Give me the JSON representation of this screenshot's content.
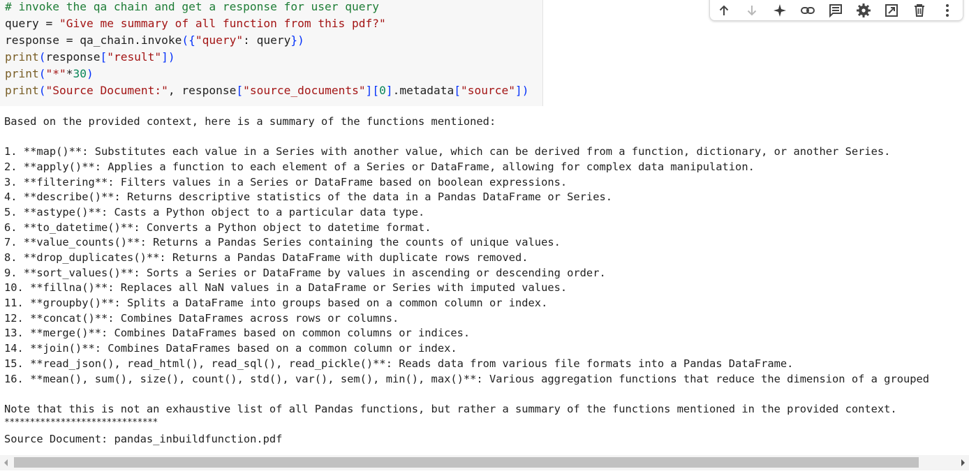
{
  "code": {
    "comment": "# invoke the qa chain and get a response for user query",
    "line2": {
      "var": "query",
      "op": " = ",
      "str": "\"Give me summary of all function from this pdf?\""
    },
    "line3": {
      "var": "response",
      "op": " = ",
      "call": "qa_chain.invoke",
      "open": "({",
      "key": "\"query\"",
      "colon": ": ",
      "arg": "query",
      "close": "})"
    },
    "line4": {
      "fn": "print",
      "open": "(",
      "var": "response",
      "lb": "[",
      "key": "\"result\"",
      "rb": "]",
      "close": ")"
    },
    "line5": {
      "fn": "print",
      "open": "(",
      "str": "\"*\"",
      "op": "*",
      "num": "30",
      "close": ")"
    },
    "line6": {
      "fn": "print",
      "open": "(",
      "str": "\"Source Document:\"",
      "comma": ", ",
      "var": "response",
      "lb1": "[",
      "key1": "\"source_documents\"",
      "rb1": "]",
      "lb2": "[",
      "idx": "0",
      "rb2": "]",
      "attr": ".metadata",
      "lb3": "[",
      "key3": "\"source\"",
      "rb3": "]",
      "close": ")"
    }
  },
  "toolbar": {
    "icons": [
      "arrow-up-icon",
      "arrow-down-icon",
      "sparkle-icon",
      "link-icon",
      "comment-icon",
      "gear-icon",
      "mirror-cell-icon",
      "trash-icon",
      "more-vert-icon"
    ]
  },
  "output": {
    "intro": "Based on the provided context, here is a summary of the functions mentioned:",
    "items": [
      "1. **map()**: Substitutes each value in a Series with another value, which can be derived from a function, dictionary, or another Series.",
      "2. **apply()**: Applies a function to each element of a Series or DataFrame, allowing for complex data manipulation.",
      "3. **filtering**: Filters values in a Series or DataFrame based on boolean expressions.",
      "4. **describe()**: Returns descriptive statistics of the data in a Pandas DataFrame or Series.",
      "5. **astype()**: Casts a Python object to a particular data type.",
      "6. **to_datetime()**: Converts a Python object to datetime format.",
      "7. **value_counts()**: Returns a Pandas Series containing the counts of unique values.",
      "8. **drop_duplicates()**: Returns a Pandas DataFrame with duplicate rows removed.",
      "9. **sort_values()**: Sorts a Series or DataFrame by values in ascending or descending order.",
      "10. **fillna()**: Replaces all NaN values in a DataFrame or Series with imputed values.",
      "11. **groupby()**: Splits a DataFrame into groups based on a common column or index.",
      "12. **concat()**: Combines DataFrames across rows or columns.",
      "13. **merge()**: Combines DataFrames based on common columns or indices.",
      "14. **join()**: Combines DataFrames based on a common column or index.",
      "15. **read_json(), read_html(), read_sql(), read_pickle()**: Reads data from various file formats into a Pandas DataFrame.",
      "16. **mean(), sum(), size(), count(), std(), var(), sem(), min(), max()**: Various aggregation functions that reduce the dimension of a grouped"
    ],
    "note": "Note that this is not an exhaustive list of all Pandas functions, but rather a summary of the functions mentioned in the provided context.",
    "stars": "******************************",
    "source": "Source Document: pandas_inbuildfunction.pdf"
  },
  "colors": {
    "comment": "#1e7d36",
    "string": "#a31515",
    "number": "#098658",
    "function": "#795e26",
    "bracket": "#0431fa"
  }
}
